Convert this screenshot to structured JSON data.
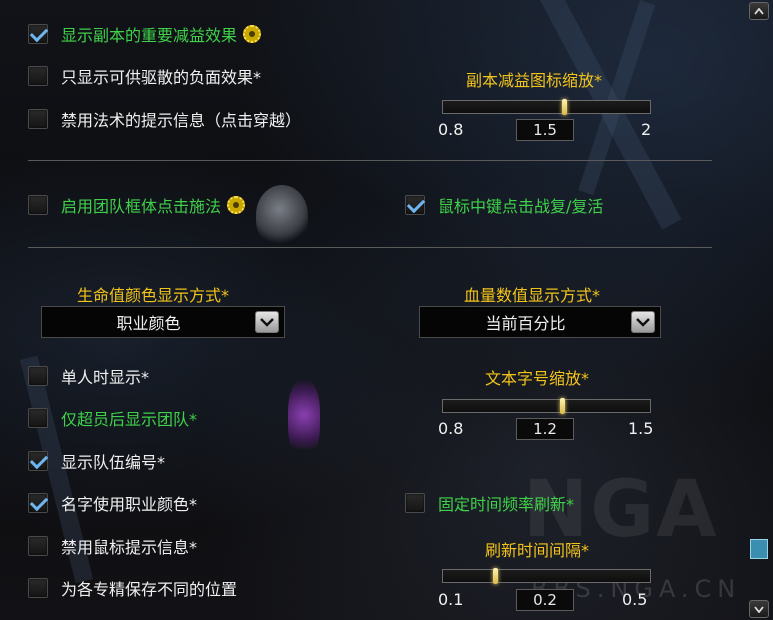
{
  "options": {
    "show_raid_buffs": {
      "label": "显示副本的重要减益效果",
      "checked": true
    },
    "show_dispellable_only": {
      "label": "只显示可供驱散的负面效果*",
      "checked": false
    },
    "disable_spell_tooltip": {
      "label": "禁用法术的提示信息（点击穿越）",
      "checked": false
    },
    "raid_frame_click_cast": {
      "label": "启用团队框体点击施法",
      "checked": false
    },
    "middle_click_resurrect": {
      "label": "鼠标中键点击战复/复活",
      "checked": true
    },
    "show_when_solo": {
      "label": "单人时显示*",
      "checked": false
    },
    "show_raid_when_over_party": {
      "label": "仅超员后显示团队*",
      "checked": false
    },
    "show_group_number": {
      "label": "显示队伍编号*",
      "checked": true
    },
    "name_class_color": {
      "label": "名字使用职业颜色*",
      "checked": true
    },
    "disable_mouse_tooltip": {
      "label": "禁用鼠标提示信息*",
      "checked": false
    },
    "fixed_refresh_rate": {
      "label": "固定时间频率刷新*",
      "checked": false
    },
    "save_per_spec_position": {
      "label": "为各专精保存不同的位置",
      "checked": false
    }
  },
  "sliders": {
    "raid_debuff_icon_scale": {
      "title": "副本减益图标缩放*",
      "min": "0.8",
      "max": "2",
      "value": "1.5",
      "fraction": 0.5833
    },
    "text_font_scale": {
      "title": "文本字号缩放*",
      "min": "0.8",
      "max": "1.5",
      "value": "1.2",
      "fraction": 0.5714
    },
    "refresh_interval": {
      "title": "刷新时间间隔*",
      "min": "0.1",
      "max": "0.5",
      "value": "0.2",
      "fraction": 0.25
    }
  },
  "dropdowns": {
    "health_color_mode": {
      "title": "生命值颜色显示方式*",
      "value": "职业颜色"
    },
    "health_text_mode": {
      "title": "血量数值显示方式*",
      "value": "当前百分比"
    }
  },
  "watermark": {
    "logo": "NGA",
    "url": "BBS.NGA.CN"
  },
  "colors": {
    "green_label": "#3fd14a",
    "gold_title": "#f2c41a",
    "check": "#6fb6f0",
    "scroll_thumb": "#3a8fb0"
  },
  "icons": [
    "check-icon",
    "gear-icon",
    "chevron-down-icon",
    "scroll-up-icon",
    "scroll-down-icon"
  ]
}
